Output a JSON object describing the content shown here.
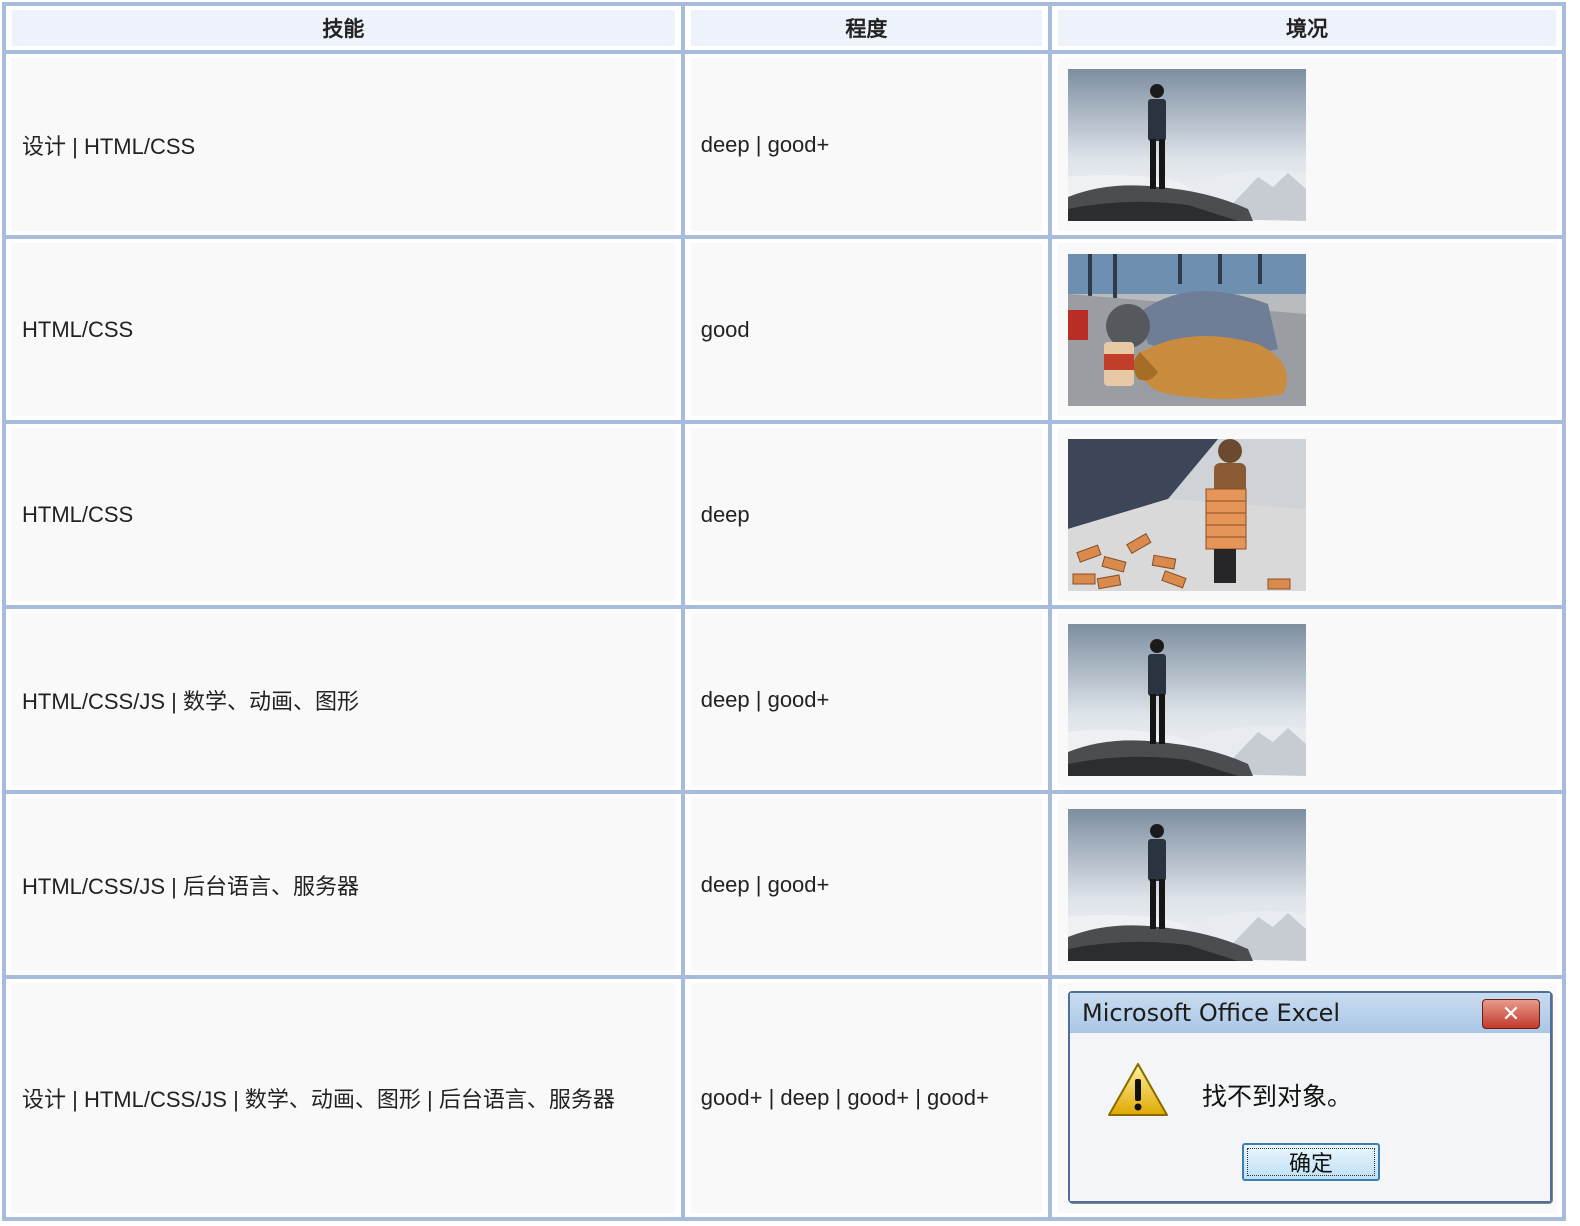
{
  "table": {
    "headers": [
      "技能",
      "程度",
      "境况"
    ],
    "rows": [
      {
        "skill": "设计 | HTML/CSS",
        "level": "deep | good+",
        "image": "man-on-cliff-photo"
      },
      {
        "skill": "HTML/CSS",
        "level": "good",
        "image": "beggar-with-dog-photo"
      },
      {
        "skill": "HTML/CSS",
        "level": "deep",
        "image": "child-carrying-bricks-photo"
      },
      {
        "skill": "HTML/CSS/JS | 数学、动画、图形",
        "level": "deep | good+",
        "image": "man-on-cliff-photo"
      },
      {
        "skill": "HTML/CSS/JS | 后台语言、服务器",
        "level": "deep | good+",
        "image": "man-on-cliff-photo"
      },
      {
        "skill": "设计 | HTML/CSS/JS | 数学、动画、图形 | 后台语言、服务器",
        "level": "good+ | deep | good+ | good+",
        "image": "excel-error-dialog"
      }
    ]
  },
  "dialog": {
    "title": "Microsoft Office Excel",
    "close_label": "✕",
    "message": "找不到对象。",
    "ok_label": "确定",
    "icon": "warning-icon"
  },
  "colors": {
    "border": "#a7bcdc",
    "header_bg": "#eef2fb",
    "cell_bg": "#f9f9f9"
  }
}
